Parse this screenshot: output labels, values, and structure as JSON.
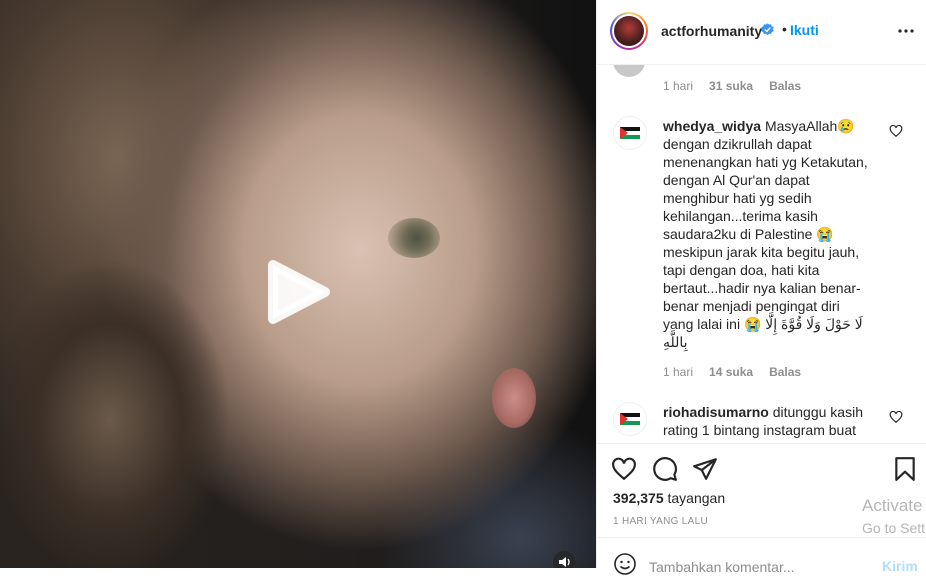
{
  "post": {
    "username": "actforhumanity",
    "follow_label": "Ikuti",
    "dot": "•"
  },
  "comments": {
    "previous": {
      "time": "1 hari",
      "likes": "31 suka",
      "reply": "Balas"
    },
    "items": [
      {
        "username": "whedya_widya",
        "text": "MasyaAllah😢 dengan dzikrullah dapat menenangkan hati yg Ketakutan, dengan Al Qur'an dapat menghibur hati yg sedih kehilangan...terima kasih saudara2ku di Palestine 😭 meskipun jarak kita begitu jauh, tapi dengan doa, hati kita bertaut...hadir nya kalian benar-benar menjadi pengingat diri yang lalai ini 😭 لَا حَوْلَ وَلَا قُوَّةَ إِلَّا بِاللَّهِ",
        "time": "1 hari",
        "likes": "14 suka",
        "reply": "Balas"
      },
      {
        "username": "riohadisumarno",
        "text": "ditunggu kasih rating 1 bintang instagram buat"
      }
    ]
  },
  "actions": {
    "views_count": "392,375",
    "views_label": "tayangan",
    "date": "1 hari yang lalu"
  },
  "add_comment": {
    "placeholder": "Tambahkan komentar...",
    "post_label": "Kirim"
  },
  "watermark": {
    "line1": "Activate",
    "line2": "Go to Sett"
  },
  "colors": {
    "accent": "#0095f6",
    "text": "#262626",
    "muted": "#8e8e8e",
    "border": "#efefef"
  }
}
